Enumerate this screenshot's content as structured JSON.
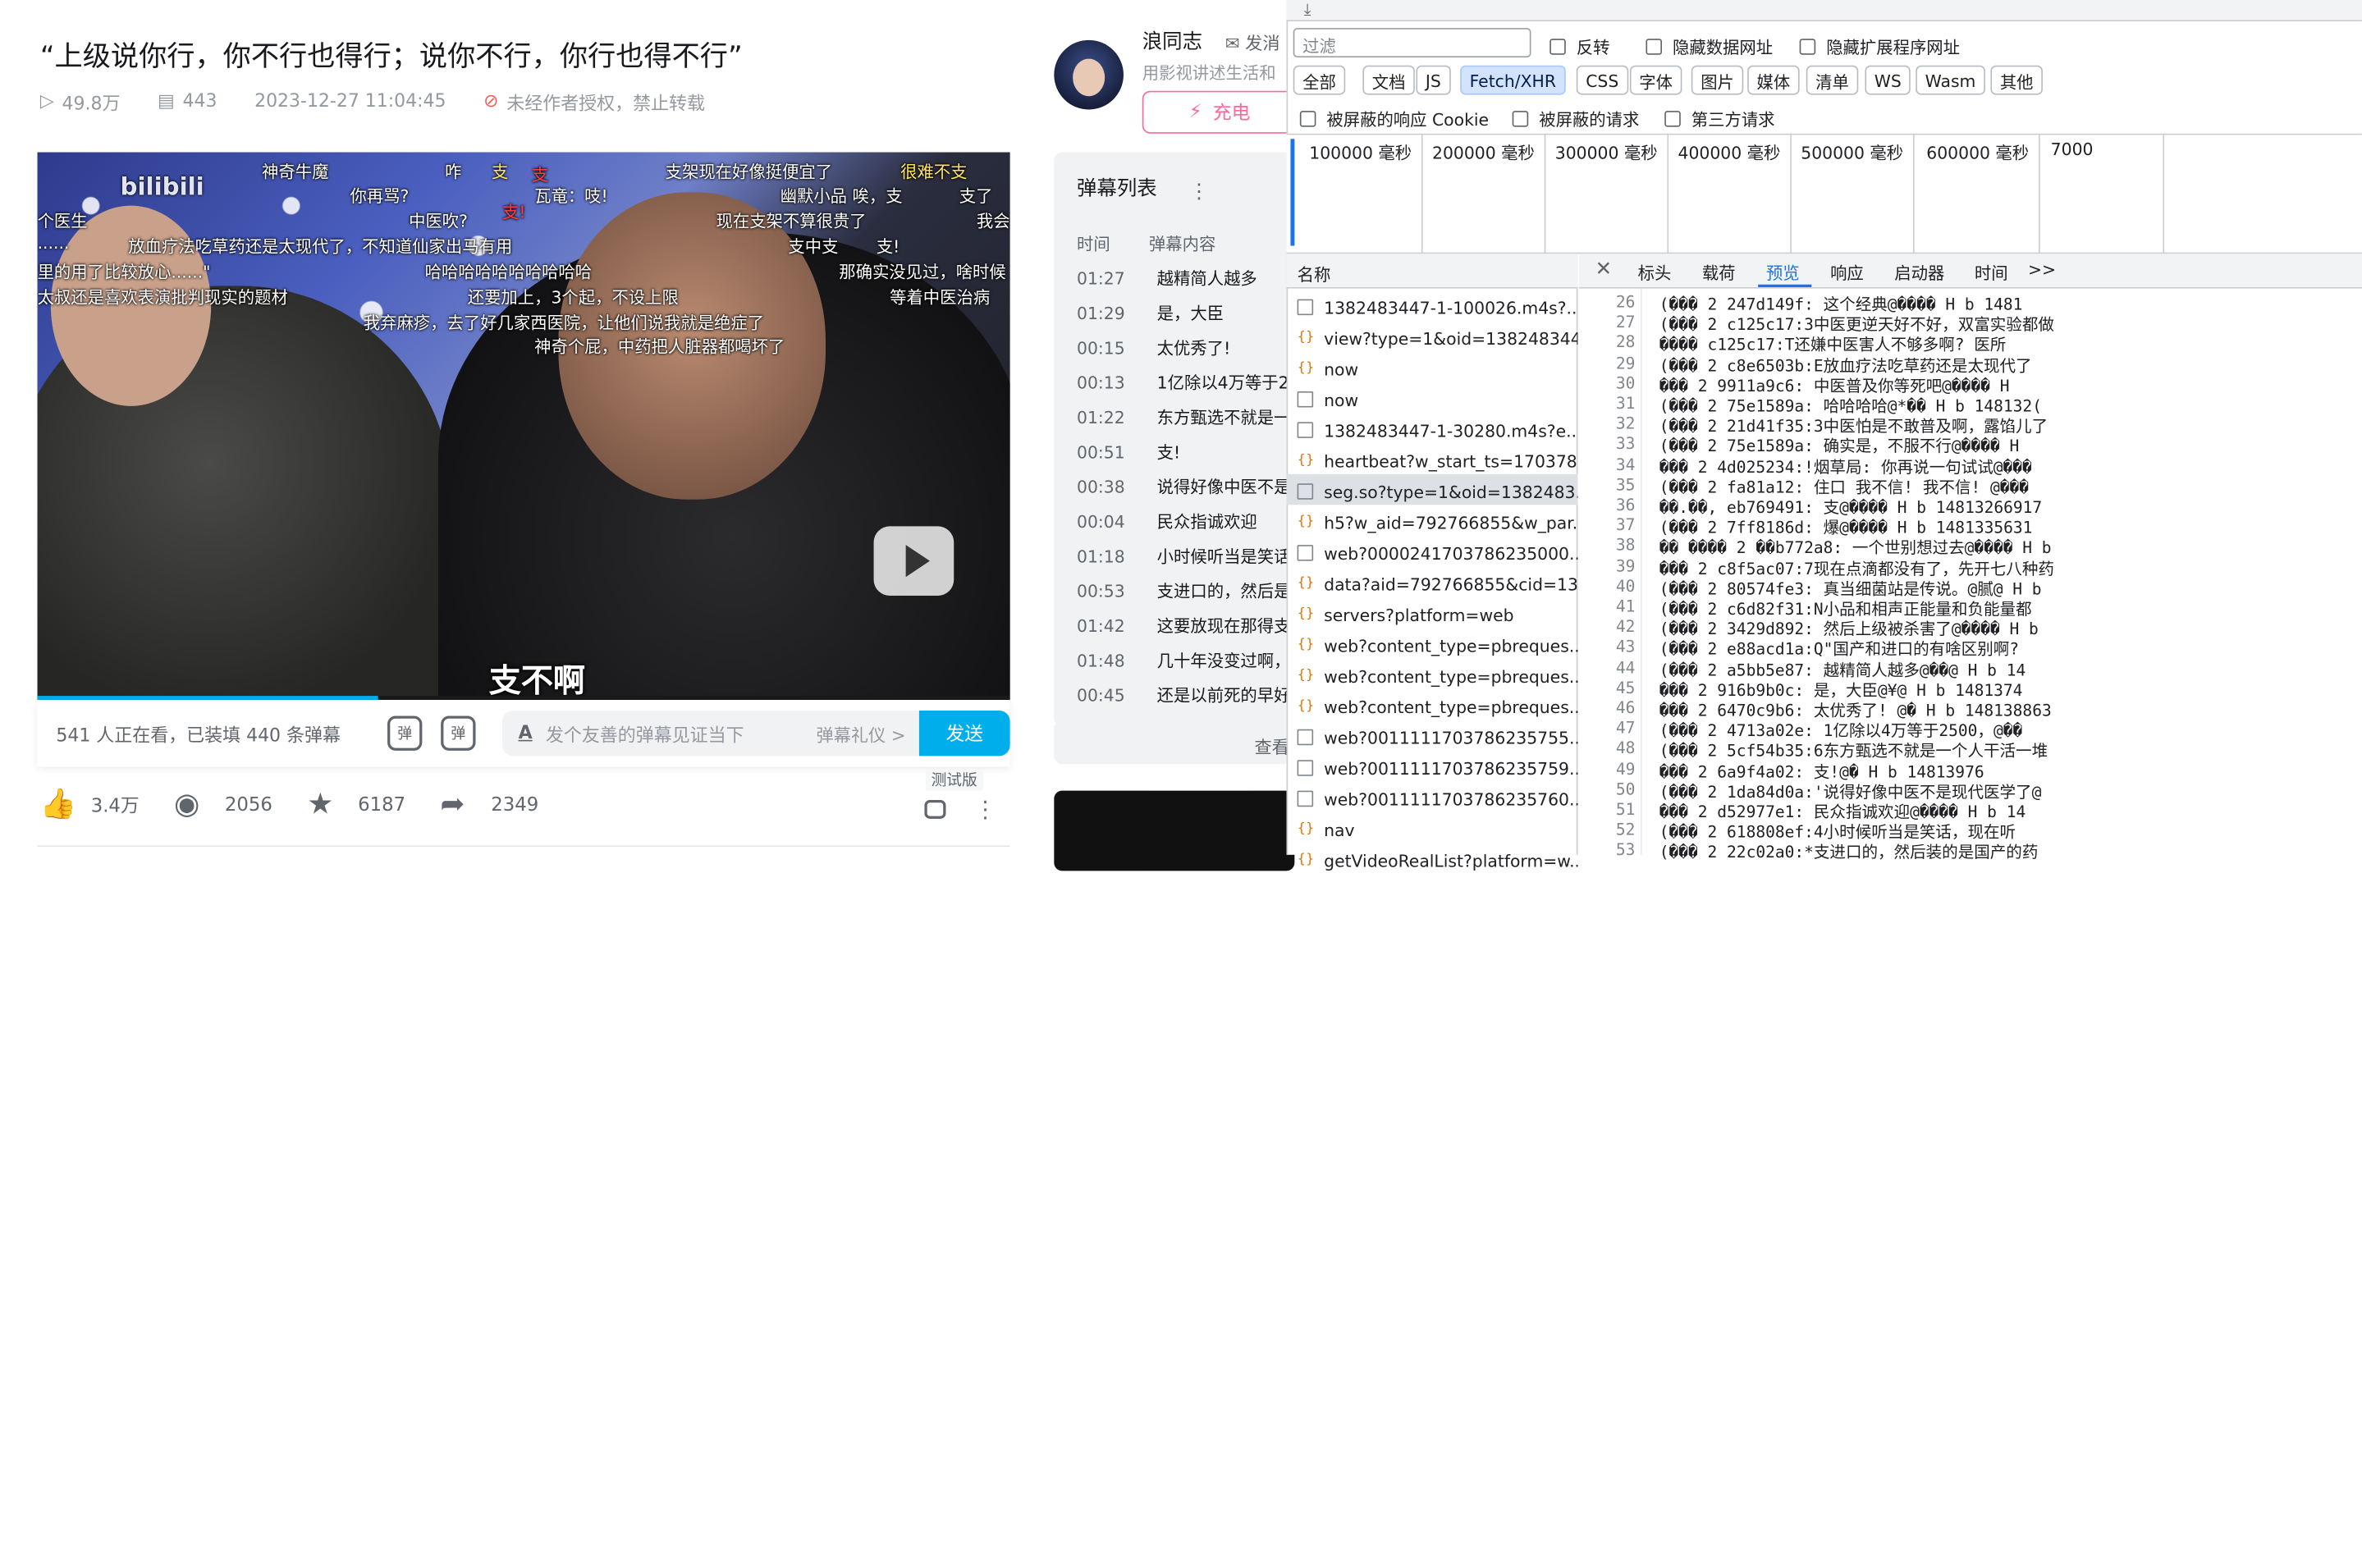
{
  "video": {
    "title": "“上级说你行，你不行也得行；说你不行，你行也得不行”",
    "views": "49.8万",
    "danmaku_count": "443",
    "date": "2023-12-27 11:04:45",
    "copyright": "未经作者授权，禁止转载",
    "subtitle": "支不啊",
    "danmaku": [
      "神奇牛魔",
      "支",
      "支架现在好像挺便宜了",
      "很难不支",
      "你再骂?",
      "瓦竜：吱!",
      "幽默小品 唉，支",
      "支了",
      "中医吹?",
      "现在支架不算很贵了",
      "我会",
      "放血疗法吃草药还是太现代了，不知道仙家出马有用",
      "支中支",
      "支!",
      "哈哈哈哈哈哈哈哈哈哈",
      "那确实没见过，啥时候",
      "还要加上，3个起，不设上限",
      "等着中医治病",
      "我弃麻疹，去了好几家西医院，让他们说我就是绝症了",
      "神奇个屁，中药把人脏器都喝坏了",
      "支",
      "支!",
      "个医生",
      "......",
      "里的用了比较放心......\"",
      "太叔还是喜欢表演批判现实的题材",
      "咋",
      "bilibili"
    ]
  },
  "danmaku_bar": {
    "viewers": "541 人正在看，已装填 440 条弹幕",
    "placeholder": "发个友善的弹幕见证当下",
    "etiquette": "弹幕礼仪 >",
    "send": "发送",
    "toggle_label": "弹",
    "setting_label": "弹"
  },
  "actions": {
    "like": "3.4万",
    "coin": "2056",
    "fav": "6187",
    "share": "2349",
    "test_tag": "测试版"
  },
  "uploader": {
    "name": "浪同志",
    "message": "发消",
    "sign": "用影视讲述生活和",
    "charge": "充电"
  },
  "danmaku_list": {
    "title": "弹幕列表",
    "col_time": "时间",
    "col_content": "弹幕内容",
    "rows": [
      {
        "time": "01:27",
        "text": "越精简人越多"
      },
      {
        "time": "01:29",
        "text": "是，大臣"
      },
      {
        "time": "00:15",
        "text": "太优秀了!"
      },
      {
        "time": "00:13",
        "text": "1亿除以4万等于2"
      },
      {
        "time": "01:22",
        "text": "东方甄选不就是一"
      },
      {
        "time": "00:51",
        "text": "支!"
      },
      {
        "time": "00:38",
        "text": "说得好像中医不是"
      },
      {
        "time": "00:04",
        "text": "民众指诚欢迎"
      },
      {
        "time": "01:18",
        "text": "小时候听当是笑话"
      },
      {
        "time": "00:53",
        "text": "支进口的，然后是"
      },
      {
        "time": "01:42",
        "text": "这要放现在那得支"
      },
      {
        "time": "01:48",
        "text": "几十年没变过啊，"
      },
      {
        "time": "00:45",
        "text": "还是以前死的早好"
      }
    ],
    "view_all": "查看"
  },
  "devtools": {
    "filter_placeholder": "过滤",
    "invert": "反转",
    "hide_data_urls": "隐藏数据网址",
    "hide_ext_urls": "隐藏扩展程序网址",
    "types": [
      "全部",
      "文档",
      "JS",
      "Fetch/XHR",
      "CSS",
      "字体",
      "图片",
      "媒体",
      "清单",
      "WS",
      "Wasm",
      "其他"
    ],
    "active_type": "Fetch/XHR",
    "blocked_cookies": "被屏蔽的响应 Cookie",
    "blocked_requests": "被屏蔽的请求",
    "third_party": "第三方请求",
    "timeline_ticks": [
      "100000 毫秒",
      "200000 毫秒",
      "300000 毫秒",
      "400000 毫秒",
      "500000 毫秒",
      "600000 毫秒",
      "7000"
    ],
    "name_header": "名称",
    "requests": [
      {
        "name": "1382483447-1-100026.m4s?...",
        "kind": "doc"
      },
      {
        "name": "view?type=1&oid=138248344...",
        "kind": "xhr"
      },
      {
        "name": "now",
        "kind": "xhr"
      },
      {
        "name": "now",
        "kind": "doc"
      },
      {
        "name": "1382483447-1-30280.m4s?e...",
        "kind": "doc"
      },
      {
        "name": "heartbeat?w_start_ts=170378...",
        "kind": "xhr"
      },
      {
        "name": "seg.so?type=1&oid=1382483...",
        "kind": "doc",
        "selected": true
      },
      {
        "name": "h5?w_aid=792766855&w_par...",
        "kind": "xhr"
      },
      {
        "name": "web?0000241703786235000...",
        "kind": "doc"
      },
      {
        "name": "data?aid=792766855&cid=13...",
        "kind": "xhr"
      },
      {
        "name": "servers?platform=web",
        "kind": "xhr"
      },
      {
        "name": "web?content_type=pbreques...",
        "kind": "xhr"
      },
      {
        "name": "web?content_type=pbreques...",
        "kind": "xhr"
      },
      {
        "name": "web?content_type=pbreques...",
        "kind": "xhr"
      },
      {
        "name": "web?0011111703786235755...",
        "kind": "doc"
      },
      {
        "name": "web?0011111703786235759...",
        "kind": "doc"
      },
      {
        "name": "web?0011111703786235760...",
        "kind": "doc"
      },
      {
        "name": "nav",
        "kind": "xhr"
      },
      {
        "name": "getVideoRealList?platform=w...",
        "kind": "xhr"
      }
    ],
    "detail_tabs": [
      "标头",
      "载荷",
      "预览",
      "响应",
      "启动器",
      "时间"
    ],
    "active_tab": "预览",
    "more_tabs": ">>",
    "code_lines": [
      {
        "n": "26",
        "t": "(��� 2 247d149f: 这个经典@���� H b 1481"
      },
      {
        "n": "27",
        "t": "(��� 2 c125c17:3中医更逆天好不好，双富实验都做"
      },
      {
        "n": "28",
        "t": "���� c125c17:T还嫌中医害人不够多啊? 医所"
      },
      {
        "n": "29",
        "t": "(��� 2 c8e6503b:E放血疗法吃草药还是太现代了"
      },
      {
        "n": "30",
        "t": "��� 2 9911a9c6: 中医普及你等死吧@���� H"
      },
      {
        "n": "31",
        "t": "(��� 2 75e1589a: 哈哈哈哈@*�� H b 148132("
      },
      {
        "n": "32",
        "t": "(��� 2 21d41f35:3中医怕是不敢普及啊，露馅儿了"
      },
      {
        "n": "33",
        "t": "(��� 2 75e1589a: 确实是，不服不行@���� H"
      },
      {
        "n": "34",
        "t": "��� 2 4d025234:!烟草局: 你再说一句试试@���"
      },
      {
        "n": "35",
        "t": "(��� 2 fa81a12: 住口 我不信! 我不信! @���"
      },
      {
        "n": "36",
        "t": "��.��, eb769491: 支@���� H b 14813266917"
      },
      {
        "n": "37",
        "t": "(��� 2 7ff8186d: 爆@���� H b 1481335631"
      },
      {
        "n": "38",
        "t": "�� ���� 2 ��b772a8: 一个世别想过去@���� H b"
      },
      {
        "n": "39",
        "t": "��� 2 c8f5ac07:7现在点滴都没有了，先开七八种药"
      },
      {
        "n": "40",
        "t": "(��� 2 80574fe3: 真当细菌站是传说。@腻@ H b"
      },
      {
        "n": "41",
        "t": "(��� 2 c6d82f31:N小品和相声正能量和负能量都"
      },
      {
        "n": "42",
        "t": "(��� 2 3429d892: 然后上级被杀害了@���� H b"
      },
      {
        "n": "43",
        "t": "(��� 2 e88acd1a:Q\"国产和进口的有啥区别啊?"
      },
      {
        "n": "44",
        "t": "(��� 2 a5bb5e87: 越精简人越多@��@ H b 14"
      },
      {
        "n": "45",
        "t": "��� 2 916b9b0c: 是，大臣@¥@ H b 1481374"
      },
      {
        "n": "46",
        "t": "��� 2 6470c9b6: 太优秀了! @� H b 148138863"
      },
      {
        "n": "47",
        "t": "(��� 2 4713a02e: 1亿除以4万等于2500，@��"
      },
      {
        "n": "48",
        "t": "(��� 2 5cf54b35:6东方甄选不就是一个人干活一堆"
      },
      {
        "n": "49",
        "t": "��� 2 6a9f4a02: 支!@� H b 14813976"
      },
      {
        "n": "50",
        "t": "(��� 2 1da84d0a:'说得好像中医不是现代医学了@"
      },
      {
        "n": "51",
        "t": "��� 2 d52977e1: 民众指诚欢迎@���� H b 14"
      },
      {
        "n": "52",
        "t": "(��� 2 618808ef:4小时候听当是笑话，现在听"
      },
      {
        "n": "53",
        "t": "(��� 2 22c02a0:*支进口的，然后装的是国产的药"
      }
    ]
  }
}
